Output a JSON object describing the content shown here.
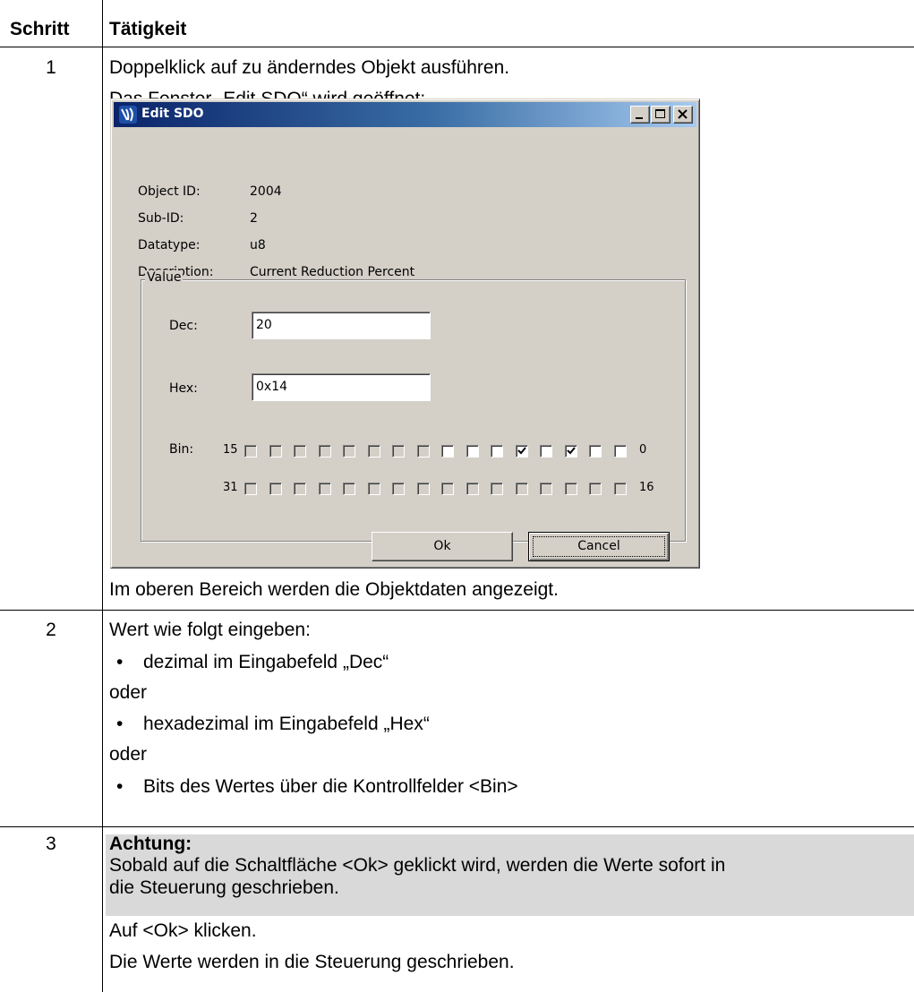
{
  "header": {
    "step": "Schritt",
    "activity": "Tätigkeit"
  },
  "steps": [
    {
      "number": "1",
      "lines": [
        "Doppelklick auf zu änderndes Objekt ausführen.",
        "Das Fenster „Edit SDO“ wird geöffnet:"
      ],
      "after": "Im oberen Bereich werden die Objektdaten angezeigt."
    },
    {
      "number": "2",
      "intro": "Wert wie folgt eingeben:",
      "bullet1": "dezimal im Eingabefeld „Dec“",
      "or1": "oder",
      "bullet2": "hexadezimal im Eingabefeld „Hex“",
      "or2": "oder",
      "bullet3": "Bits des Wertes über die Kontrollfelder <Bin>"
    },
    {
      "number": "3",
      "warning_title": "Achtung:",
      "warning_line1": "Sobald auf die Schaltfläche <Ok> geklickt wird, werden die Werte sofort in",
      "warning_line2": "die Steuerung geschrieben.",
      "action": "Auf <Ok> klicken.",
      "result": "Die Werte werden in die Steuerung geschrieben."
    }
  ],
  "dialog": {
    "title": "Edit SDO",
    "title_icon": "app-logo-icon",
    "window_buttons": [
      "minimize-icon",
      "maximize-icon",
      "close-icon"
    ],
    "info": [
      {
        "label": "Object ID:",
        "value": "2004"
      },
      {
        "label": "Sub-ID:",
        "value": "2"
      },
      {
        "label": "Datatype:",
        "value": "u8"
      },
      {
        "label": "Description:",
        "value": "Current Reduction Percent"
      }
    ],
    "group_label": "Value",
    "dec_label": "Dec:",
    "dec_value": "20",
    "hex_label": "Hex:",
    "hex_value": "0x14",
    "bin_label": "Bin:",
    "row1_left": "15",
    "row1_right": "0",
    "row2_left": "31",
    "row2_right": "16",
    "bits_15_to_0": [
      false,
      false,
      false,
      false,
      false,
      false,
      false,
      false,
      false,
      false,
      false,
      true,
      false,
      true,
      false,
      false
    ],
    "bits_15_to_0_enabled": [
      false,
      false,
      false,
      false,
      false,
      false,
      false,
      false,
      true,
      true,
      true,
      true,
      true,
      true,
      true,
      true
    ],
    "bits_31_to_16": [
      false,
      false,
      false,
      false,
      false,
      false,
      false,
      false,
      false,
      false,
      false,
      false,
      false,
      false,
      false,
      false
    ],
    "ok_label": "Ok",
    "cancel_label": "Cancel"
  },
  "colors": {
    "titlebar_start": "#0a246a",
    "titlebar_end": "#a6caf0",
    "dialog_face": "#d4d0c8",
    "warning_bg": "#d9d9d9"
  }
}
